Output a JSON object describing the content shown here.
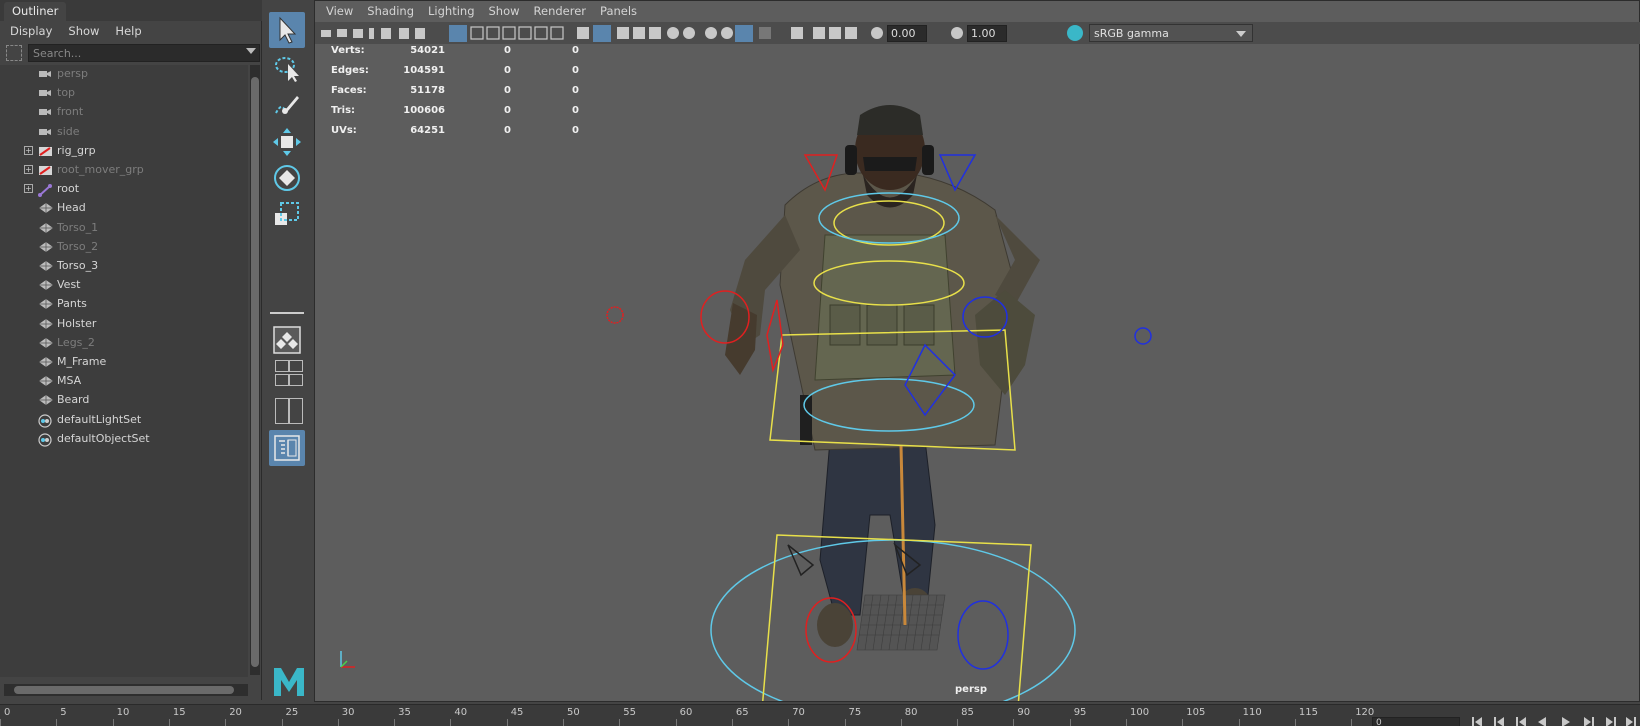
{
  "outliner": {
    "tab_title": "Outliner",
    "menu": [
      "Display",
      "Show",
      "Help"
    ],
    "search_placeholder": "Search...",
    "items": [
      {
        "label": "persp",
        "icon": "camera-icon",
        "dim": true,
        "expandable": false
      },
      {
        "label": "top",
        "icon": "camera-icon",
        "dim": true,
        "expandable": false
      },
      {
        "label": "front",
        "icon": "camera-icon",
        "dim": true,
        "expandable": false
      },
      {
        "label": "side",
        "icon": "camera-icon",
        "dim": true,
        "expandable": false
      },
      {
        "label": "rig_grp",
        "icon": "group-icon",
        "dim": false,
        "expandable": true
      },
      {
        "label": "root_mover_grp",
        "icon": "group-icon",
        "dim": true,
        "expandable": true
      },
      {
        "label": "root",
        "icon": "joint-icon",
        "dim": false,
        "expandable": true
      },
      {
        "label": "Head",
        "icon": "mesh-icon",
        "dim": false,
        "expandable": false
      },
      {
        "label": "Torso_1",
        "icon": "mesh-icon",
        "dim": true,
        "expandable": false
      },
      {
        "label": "Torso_2",
        "icon": "mesh-icon",
        "dim": true,
        "expandable": false
      },
      {
        "label": "Torso_3",
        "icon": "mesh-icon",
        "dim": false,
        "expandable": false
      },
      {
        "label": "Vest",
        "icon": "mesh-icon",
        "dim": false,
        "expandable": false
      },
      {
        "label": "Pants",
        "icon": "mesh-icon",
        "dim": false,
        "expandable": false
      },
      {
        "label": "Holster",
        "icon": "mesh-icon",
        "dim": false,
        "expandable": false
      },
      {
        "label": "Legs_2",
        "icon": "mesh-icon",
        "dim": true,
        "expandable": false
      },
      {
        "label": "M_Frame",
        "icon": "mesh-icon",
        "dim": false,
        "expandable": false
      },
      {
        "label": "MSA",
        "icon": "mesh-icon",
        "dim": false,
        "expandable": false
      },
      {
        "label": "Beard",
        "icon": "mesh-icon",
        "dim": false,
        "expandable": false
      },
      {
        "label": "defaultLightSet",
        "icon": "set-icon",
        "dim": false,
        "expandable": false
      },
      {
        "label": "defaultObjectSet",
        "icon": "set-icon",
        "dim": false,
        "expandable": false
      }
    ]
  },
  "viewport": {
    "menu": [
      "View",
      "Shading",
      "Lighting",
      "Show",
      "Renderer",
      "Panels"
    ],
    "exposure": "0.00",
    "gamma": "1.00",
    "color_space": "sRGB gamma",
    "camera_label": "persp",
    "hud": [
      {
        "label": "Verts:",
        "v1": "54021",
        "v2": "0",
        "v3": "0"
      },
      {
        "label": "Edges:",
        "v1": "104591",
        "v2": "0",
        "v3": "0"
      },
      {
        "label": "Faces:",
        "v1": "51178",
        "v2": "0",
        "v3": "0"
      },
      {
        "label": "Tris:",
        "v1": "100606",
        "v2": "0",
        "v3": "0"
      },
      {
        "label": "UVs:",
        "v1": "64251",
        "v2": "0",
        "v3": "0"
      }
    ]
  },
  "timeline": {
    "ticks": [
      "0",
      "5",
      "10",
      "15",
      "20",
      "25",
      "30",
      "35",
      "40",
      "45",
      "50",
      "55",
      "60",
      "65",
      "70",
      "75",
      "80",
      "85",
      "90",
      "95",
      "100",
      "105",
      "110",
      "115",
      "120"
    ],
    "current_frame": "0"
  },
  "colors": {
    "accent": "#5a85ad",
    "viewport_bg": "#5d5d5d",
    "panel_bg": "#444444",
    "ctrl_yellow": "#e8e04a",
    "ctrl_cyan": "#5fc9e8",
    "ctrl_red": "#e02020",
    "ctrl_blue": "#2030e0"
  }
}
